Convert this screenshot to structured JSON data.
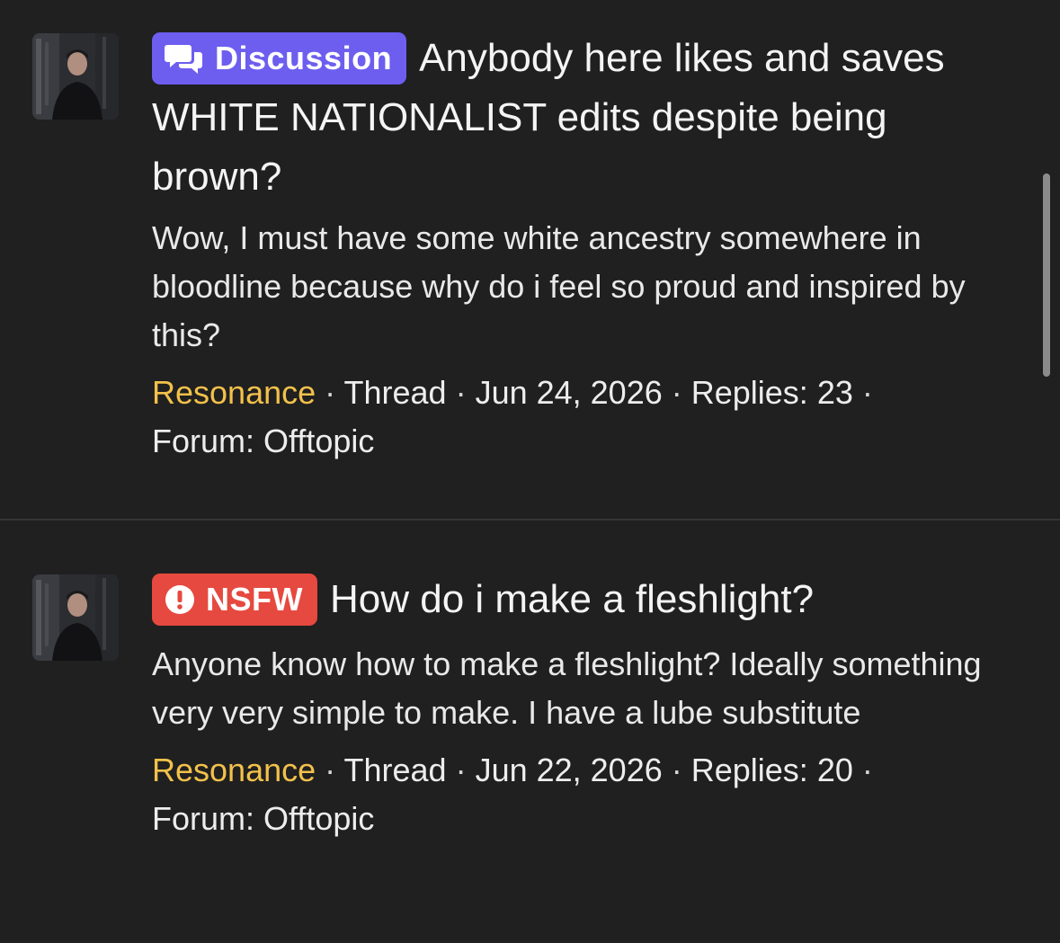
{
  "threads": [
    {
      "badge": {
        "label": "Discussion",
        "icon": "chat-bubbles-icon",
        "color": "#6d5ef0"
      },
      "title": "Anybody here likes and saves WHITE NATIONALIST edits despite being brown?",
      "excerpt": "Wow, I must have some white ancestry somewhere in bloodline because why do i feel so proud and inspired by this?",
      "meta": {
        "author": "Resonance",
        "type": "Thread",
        "date": "Jun 24, 2026",
        "replies": "Replies: 23",
        "forum": "Forum: Offtopic"
      }
    },
    {
      "badge": {
        "label": "NSFW",
        "icon": "exclamation-circle-icon",
        "color": "#e6493f"
      },
      "title": "How do i make a fleshlight?",
      "excerpt": "Anyone know how to make a fleshlight? Ideally something very very simple to make. I have a lube substitute",
      "meta": {
        "author": "Resonance",
        "type": "Thread",
        "date": "Jun 22, 2026",
        "replies": "Replies: 20",
        "forum": "Forum: Offtopic"
      }
    }
  ],
  "separator": " · ",
  "colors": {
    "background": "#202020",
    "author": "#f2c14b",
    "text": "#f4f4f4"
  }
}
